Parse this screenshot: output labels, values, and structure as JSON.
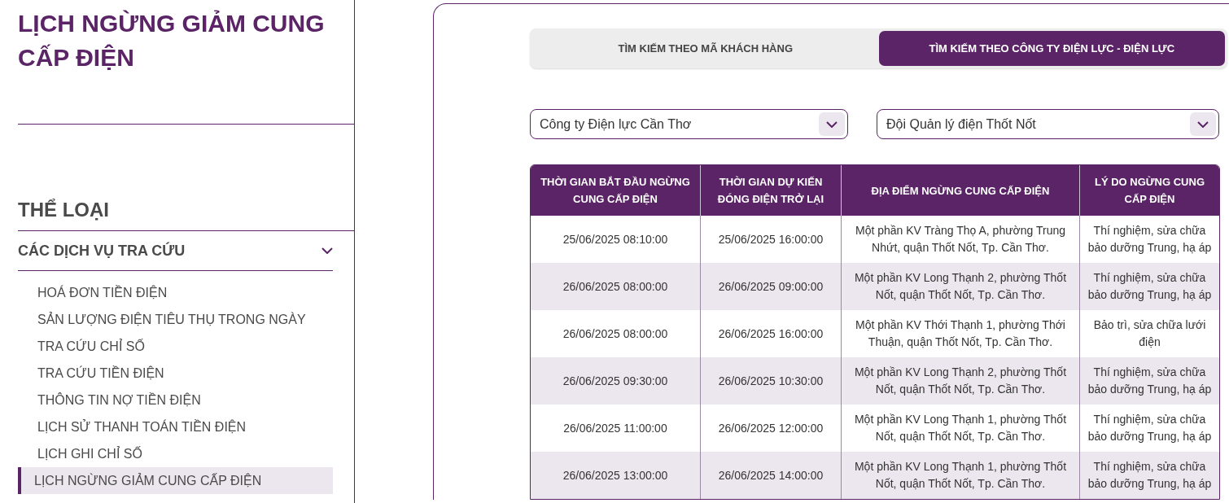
{
  "page_title": "LỊCH NGỪNG GIẢM CUNG CẤP ĐIỆN",
  "sidebar": {
    "heading": "THỂ LOẠI",
    "group": {
      "label": "CÁC DỊCH VỤ TRA CỨU",
      "expanded": true,
      "items": [
        {
          "label": "HOÁ ĐƠN TIỀN ĐIỆN",
          "selected": false
        },
        {
          "label": "SẢN LƯỢNG ĐIỆN TIÊU THỤ TRONG NGÀY",
          "selected": false
        },
        {
          "label": "TRA CỨU CHỈ SỐ",
          "selected": false
        },
        {
          "label": "TRA CỨU TIỀN ĐIỆN",
          "selected": false
        },
        {
          "label": "THÔNG TIN NỢ TIỀN ĐIỆN",
          "selected": false
        },
        {
          "label": "LỊCH SỬ THANH TOÁN TIỀN ĐIỆN",
          "selected": false
        },
        {
          "label": "LỊCH GHI CHỈ SỐ",
          "selected": false
        },
        {
          "label": "LỊCH NGỪNG GIẢM CUNG CẤP ĐIỆN",
          "selected": true
        }
      ]
    }
  },
  "tabs": [
    {
      "label": "TÌM KIẾM THEO MÃ KHÁCH HÀNG",
      "selected": false
    },
    {
      "label": "TÌM KIẾM THEO CÔNG TY ĐIỆN LỰC - ĐIỆN LỰC",
      "selected": true
    }
  ],
  "filters": [
    {
      "value": "Công ty Điện lực Cần Thơ"
    },
    {
      "value": "Đội Quản lý điện Thốt Nốt"
    }
  ],
  "table": {
    "columns": [
      "THỜI GIAN BẮT ĐẦU NGỪNG CUNG CẤP ĐIỆN",
      "THỜI GIAN DỰ KIẾN ĐÓNG ĐIỆN TRỞ LẠI",
      "ĐỊA ĐIỂM NGỪNG CUNG CẤP ĐIỆN",
      "LÝ DO NGỪNG CUNG CẤP ĐIỆN"
    ],
    "rows": [
      [
        "25/06/2025 08:10:00",
        "25/06/2025 16:00:00",
        "Một phần KV Tràng Thọ A, phường Trung Nhứt, quận Thốt Nốt, Tp. Cần Thơ.",
        "Thí nghiệm, sửa chữa bảo dưỡng Trung, hạ áp"
      ],
      [
        "26/06/2025 08:00:00",
        "26/06/2025 09:00:00",
        "Một phần KV Long Thạnh 2, phường Thốt Nốt, quận Thốt Nốt, Tp. Cần Thơ.",
        "Thí nghiệm, sửa chữa bảo dưỡng Trung, hạ áp"
      ],
      [
        "26/06/2025 08:00:00",
        "26/06/2025 16:00:00",
        "Một phần KV Thới Thạnh 1, phường Thới Thuận, quận Thốt Nốt, Tp. Cần Thơ.",
        "Bảo trì, sửa chữa lưới điện"
      ],
      [
        "26/06/2025 09:30:00",
        "26/06/2025 10:30:00",
        "Một phần KV Long Thạnh 2, phường Thốt Nốt, quận Thốt Nốt, Tp. Cần Thơ.",
        "Thí nghiệm, sửa chữa bảo dưỡng Trung, hạ áp"
      ],
      [
        "26/06/2025 11:00:00",
        "26/06/2025 12:00:00",
        "Một phần KV Long Thạnh 1, phường Thốt Nốt, quận Thốt Nốt, Tp. Cần Thơ.",
        "Thí nghiệm, sửa chữa bảo dưỡng Trung, hạ áp"
      ],
      [
        "26/06/2025 13:00:00",
        "26/06/2025 14:00:00",
        "Một phần KV Long Thạnh 1, phường Thốt Nốt, quận Thốt Nốt, Tp. Cần Thơ.",
        "Thí nghiệm, sửa chữa bảo dưỡng Trung, hạ áp"
      ]
    ]
  }
}
